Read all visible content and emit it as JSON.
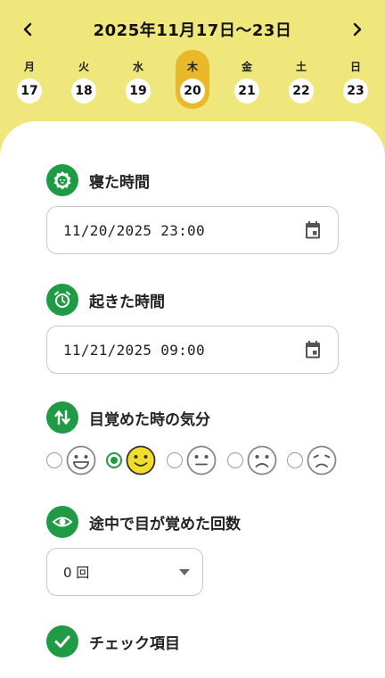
{
  "header": {
    "week_title": "2025年11月17日〜23日",
    "prev_icon": "chevron-left-icon",
    "next_icon": "chevron-right-icon",
    "days": [
      {
        "weekday": "月",
        "date": "17",
        "selected": false
      },
      {
        "weekday": "火",
        "date": "18",
        "selected": false
      },
      {
        "weekday": "水",
        "date": "19",
        "selected": false
      },
      {
        "weekday": "木",
        "date": "20",
        "selected": true
      },
      {
        "weekday": "金",
        "date": "21",
        "selected": false
      },
      {
        "weekday": "土",
        "date": "22",
        "selected": false
      },
      {
        "weekday": "日",
        "date": "23",
        "selected": false
      }
    ]
  },
  "bedtime": {
    "title": "寝た時間",
    "icon": "sleep-face-icon",
    "value": "11/20/2025  23:00",
    "picker_icon": "calendar-icon"
  },
  "waketime": {
    "title": "起きた時間",
    "icon": "alarm-clock-icon",
    "value": "11/21/2025  09:00",
    "picker_icon": "calendar-icon"
  },
  "mood": {
    "title": "目覚めた時の気分",
    "icon": "swap-arrows-icon",
    "options": [
      {
        "face": "grinning-face-icon",
        "selected": false
      },
      {
        "face": "smiling-face-icon",
        "selected": true
      },
      {
        "face": "neutral-face-icon",
        "selected": false
      },
      {
        "face": "frowning-face-icon",
        "selected": false
      },
      {
        "face": "sad-face-icon",
        "selected": false
      }
    ],
    "colors": {
      "selected_face": "#f2dc2c",
      "unselected_face": "#ffffff"
    }
  },
  "wake_count": {
    "title": "途中で目が覚めた回数",
    "icon": "eye-icon",
    "selected": "0 回"
  },
  "checklist": {
    "title": "チェック項目",
    "icon": "checkmark-icon"
  },
  "colors": {
    "header_bg": "#f0e77c",
    "selected_day": "#eab92b",
    "accent_green": "#1f9a45"
  }
}
